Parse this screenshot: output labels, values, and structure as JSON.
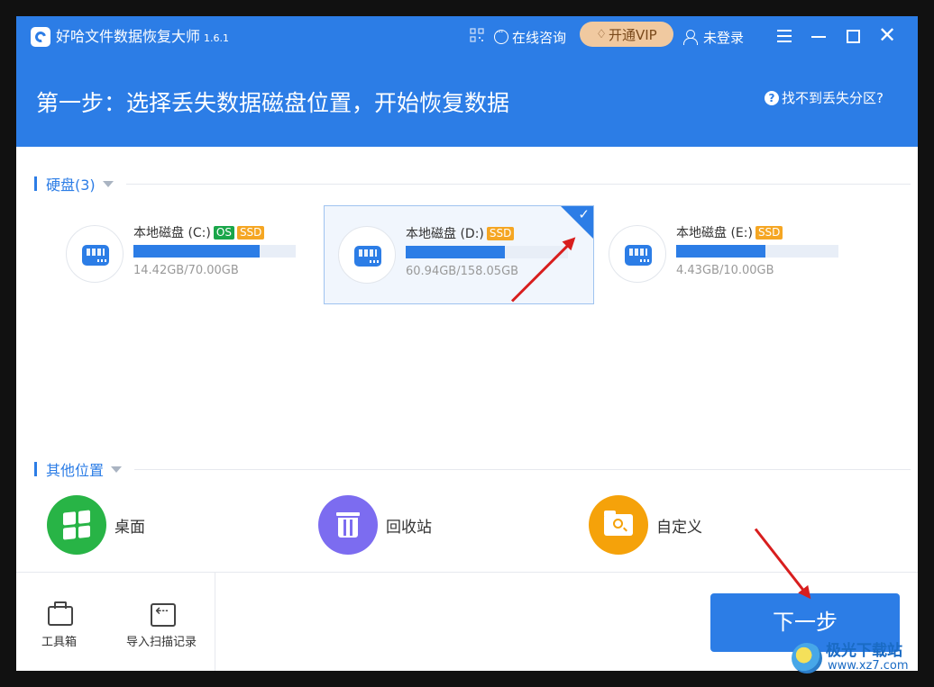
{
  "app": {
    "title": "好哈文件数据恢复大师",
    "version": "1.6.1"
  },
  "header": {
    "consult_label": "在线咨询",
    "vip_label": "开通VIP",
    "login_label": "未登录",
    "step_title": "第一步：选择丢失数据磁盘位置，开始恢复数据",
    "help_label": "找不到丢失分区?"
  },
  "disks": {
    "section_title": "硬盘(3)",
    "items": [
      {
        "name": "本地磁盘 (C:)",
        "tags": [
          "OS",
          "SSD"
        ],
        "used_fraction": 0.78,
        "size_label": "14.42GB/70.00GB",
        "selected": false
      },
      {
        "name": "本地磁盘 (D:)",
        "tags": [
          "SSD"
        ],
        "used_fraction": 0.61,
        "size_label": "60.94GB/158.05GB",
        "selected": true
      },
      {
        "name": "本地磁盘 (E:)",
        "tags": [
          "SSD"
        ],
        "used_fraction": 0.55,
        "size_label": "4.43GB/10.00GB",
        "selected": false
      }
    ]
  },
  "other_locations": {
    "section_title": "其他位置",
    "items": [
      {
        "label": "桌面",
        "icon": "windows-desktop-icon"
      },
      {
        "label": "回收站",
        "icon": "recycle-bin-icon"
      },
      {
        "label": "自定义",
        "icon": "folder-search-icon"
      }
    ]
  },
  "footer": {
    "toolbox_label": "工具箱",
    "import_label": "导入扫描记录",
    "next_label": "下一步"
  },
  "watermark": {
    "text": "极光下载站",
    "url": "www.xz7.com"
  },
  "colors": {
    "accent": "#2c7de6",
    "vip": "#f0c9a0",
    "os_tag": "#1aa64a",
    "ssd_tag": "#f5a623",
    "annotation_arrow": "#d81e1e"
  }
}
